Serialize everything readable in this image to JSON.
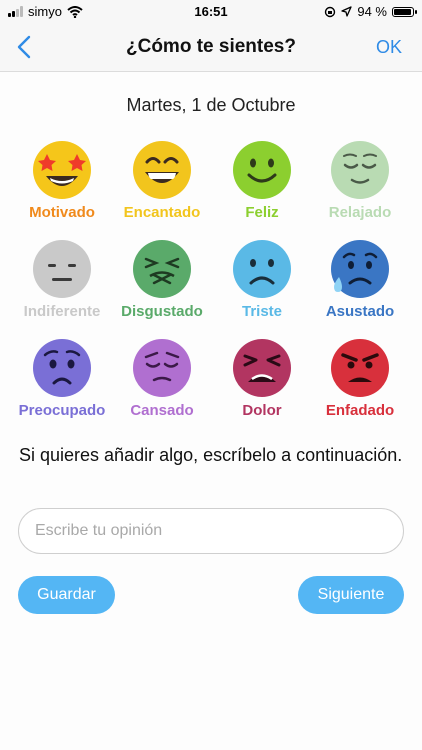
{
  "status_bar": {
    "carrier": "simyo",
    "time": "16:51",
    "battery": "94 %",
    "battery_level": 0.94,
    "signal_bars": 2
  },
  "nav": {
    "title": "¿Cómo te sientes?",
    "ok_label": "OK",
    "back_icon": "chevron-left-icon",
    "accent_color": "#2f8be6"
  },
  "date_label": "Martes, 1 de Octubre",
  "emotions": [
    {
      "label": "Motivado",
      "color": "#f08a1c",
      "icon": "star-struck-face-icon"
    },
    {
      "label": "Encantado",
      "color": "#f2c51d",
      "icon": "grinning-face-icon"
    },
    {
      "label": "Feliz",
      "color": "#8ccf2f",
      "icon": "smiling-face-icon"
    },
    {
      "label": "Relajado",
      "color": "#b9dbb3",
      "icon": "relieved-face-icon"
    },
    {
      "label": "Indiferente",
      "color": "#c9c9c9",
      "icon": "neutral-face-icon"
    },
    {
      "label": "Disgustado",
      "color": "#5aaa6a",
      "icon": "nauseated-face-icon"
    },
    {
      "label": "Triste",
      "color": "#5ab9e6",
      "icon": "sad-face-icon"
    },
    {
      "label": "Asustado",
      "color": "#3a76c4",
      "icon": "anxious-sweat-face-icon"
    },
    {
      "label": "Preocupado",
      "color": "#7a6fd6",
      "icon": "worried-face-icon"
    },
    {
      "label": "Cansado",
      "color": "#b06fd0",
      "icon": "pensive-face-icon"
    },
    {
      "label": "Dolor",
      "color": "#b23561",
      "icon": "persevering-face-icon"
    },
    {
      "label": "Enfadado",
      "color": "#d8303c",
      "icon": "angry-face-icon"
    }
  ],
  "prompt_text": "Si quieres añadir algo, escríbelo a continuación.",
  "opinion": {
    "placeholder": "Escribe tu opinión",
    "value": ""
  },
  "buttons": {
    "save_label": "Guardar",
    "next_label": "Siguiente",
    "color": "#54b6f4"
  }
}
